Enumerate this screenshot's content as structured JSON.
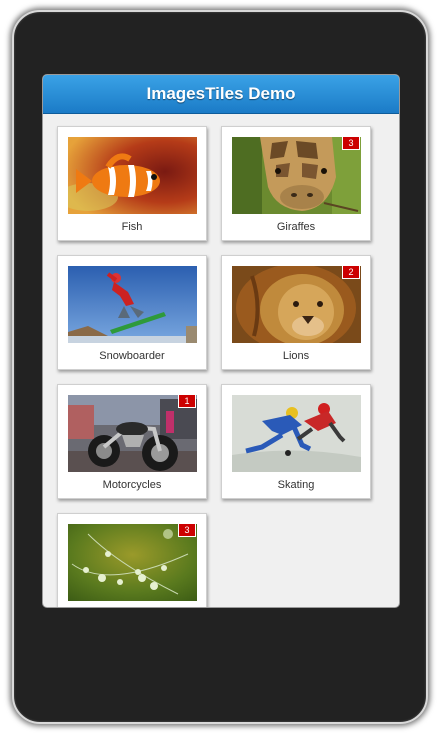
{
  "app": {
    "title": "ImagesTiles Demo"
  },
  "tiles": [
    {
      "label": "Fish",
      "badge": ""
    },
    {
      "label": "Giraffes",
      "badge": "3"
    },
    {
      "label": "Snowboarder",
      "badge": ""
    },
    {
      "label": "Lions",
      "badge": "2"
    },
    {
      "label": "Motorcycles",
      "badge": "1"
    },
    {
      "label": "Skating",
      "badge": ""
    },
    {
      "label": "",
      "badge": "3"
    }
  ],
  "colors": {
    "header": "#1b7bc7",
    "badge": "#cc0000",
    "device": "#222222"
  },
  "icons": [
    "fish-photo",
    "giraffe-photo",
    "snowboarder-photo",
    "lion-photo",
    "motorcycle-photo",
    "skating-photo",
    "dewdrops-photo"
  ]
}
